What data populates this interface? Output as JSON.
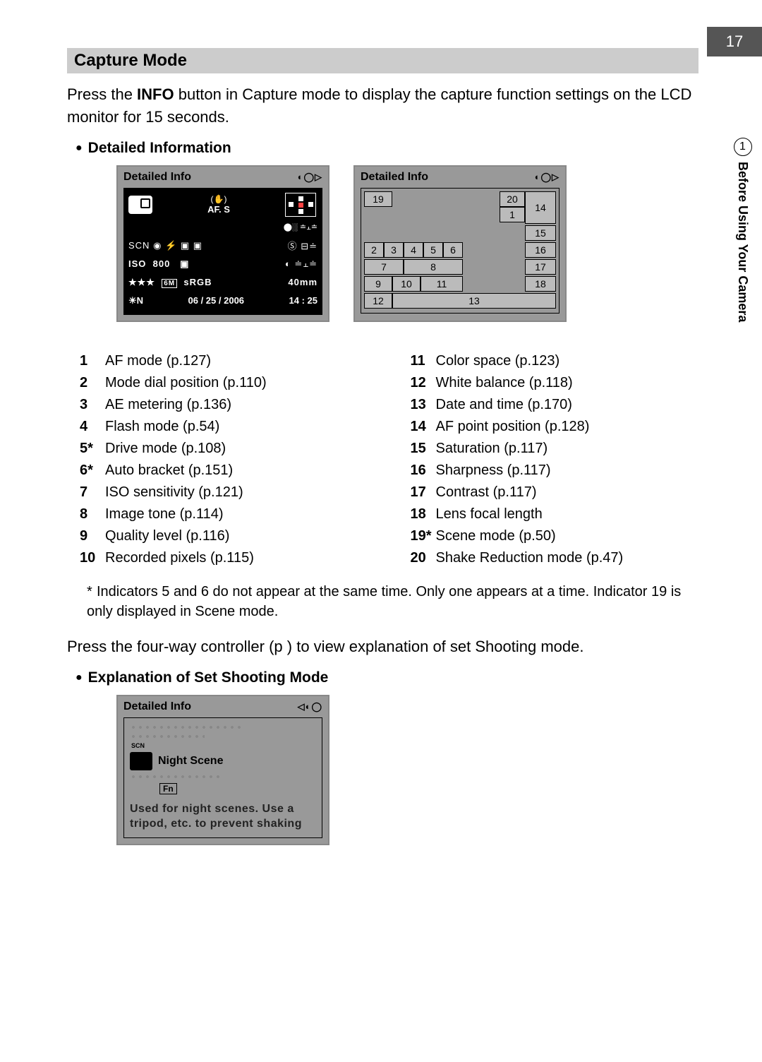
{
  "page_number": "17",
  "side_tab": {
    "number": "1",
    "label": "Before Using Your Camera"
  },
  "section_title": "Capture Mode",
  "intro_part1": "Press the ",
  "intro_bold": "INFO",
  "intro_part2": " button in Capture mode to display the capture function settings on the LCD monitor for 15 seconds.",
  "subhead1": "Detailed Information",
  "lcd1": {
    "title": "Detailed Info",
    "af_label": "AF. S",
    "scn": "SCN",
    "iso": "ISO",
    "iso_val": "800",
    "stars": "★★★",
    "mp": "6M",
    "srgb": "sRGB",
    "mm": "40mm",
    "wb": "N",
    "date": "06 / 25 / 2006",
    "time": "14 : 25"
  },
  "lcd2": {
    "title": "Detailed Info",
    "cells": {
      "c19": "19",
      "c20": "20",
      "c14": "14",
      "c1": "1",
      "c15": "15",
      "c2": "2",
      "c3": "3",
      "c4": "4",
      "c5": "5",
      "c6": "6",
      "c16": "16",
      "c7": "7",
      "c8": "8",
      "c17": "17",
      "c9": "9",
      "c10": "10",
      "c11": "11",
      "c18": "18",
      "c12": "12",
      "c13": "13"
    }
  },
  "legend_left": [
    {
      "n": "1",
      "t": "AF mode (p.127)"
    },
    {
      "n": "2",
      "t": "Mode dial position (p.110)"
    },
    {
      "n": "3",
      "t": "AE metering (p.136)"
    },
    {
      "n": "4",
      "t": "Flash mode (p.54)"
    },
    {
      "n": "5*",
      "t": "Drive mode (p.108)"
    },
    {
      "n": "6*",
      "t": "Auto bracket (p.151)"
    },
    {
      "n": "7",
      "t": "ISO sensitivity (p.121)"
    },
    {
      "n": "8",
      "t": "Image tone (p.114)"
    },
    {
      "n": "9",
      "t": "Quality level (p.116)"
    },
    {
      "n": "10",
      "t": "Recorded pixels (p.115)"
    }
  ],
  "legend_right": [
    {
      "n": "11",
      "t": "Color space (p.123)"
    },
    {
      "n": "12",
      "t": "White balance (p.118)"
    },
    {
      "n": "13",
      "t": "Date and time (p.170)"
    },
    {
      "n": "14",
      "t": "AF point position (p.128)"
    },
    {
      "n": "15",
      "t": "Saturation (p.117)"
    },
    {
      "n": "16",
      "t": "Sharpness (p.117)"
    },
    {
      "n": "17",
      "t": "Contrast (p.117)"
    },
    {
      "n": "18",
      "t": "Lens focal length"
    },
    {
      "n": "19*",
      "t": "Scene mode (p.50)"
    },
    {
      "n": "20",
      "t": "Shake Reduction mode (p.47)"
    }
  ],
  "footnote": "Indicators 5 and 6 do not appear at the same time. Only one appears at a time. Indicator 19 is only displayed in Scene mode.",
  "para2": "Press the four-way controller (p ) to view explanation of set Shooting mode.",
  "subhead2": "Explanation of Set Shooting Mode",
  "lcd3": {
    "title": "Detailed Info",
    "scn": "SCN",
    "mode": "Night Scene",
    "fn": "Fn",
    "desc": "Used for night scenes. Use a tripod, etc. to prevent shaking"
  }
}
